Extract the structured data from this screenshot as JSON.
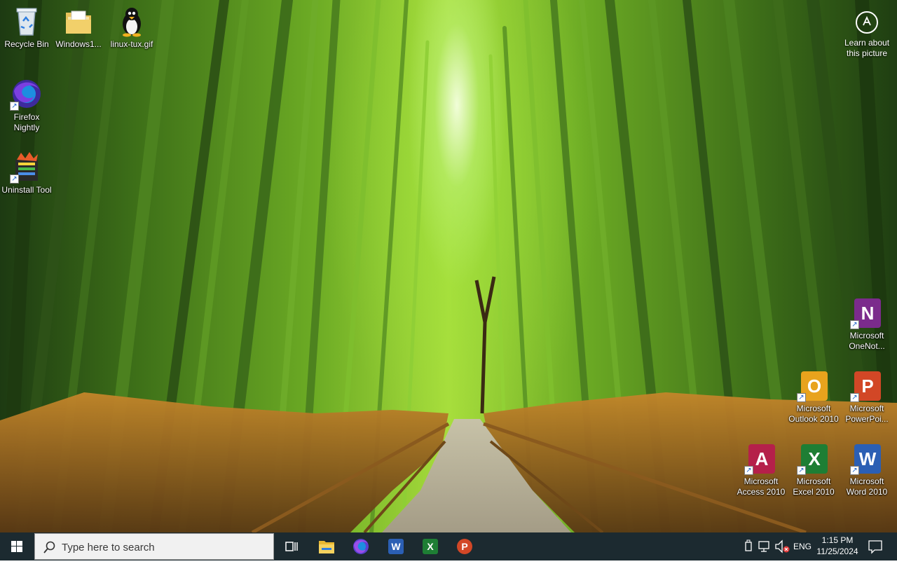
{
  "desktop": {
    "icons_left": [
      {
        "label": "Recycle Bin",
        "icon": "recycle-bin-icon"
      },
      {
        "label": "Windows1...",
        "icon": "folder-icon"
      },
      {
        "label": "linux-tux.gif",
        "icon": "tux-penguin-icon"
      },
      {
        "label": "Firefox Nightly",
        "icon": "firefox-nightly-icon"
      },
      {
        "label": "Uninstall Tool",
        "icon": "uninstall-tool-icon"
      }
    ],
    "icons_right": [
      {
        "label": "Microsoft OneNot...",
        "icon": "onenote-icon",
        "letter": "N",
        "color": "#7b2b8c"
      },
      {
        "label": "Microsoft Outlook 2010",
        "icon": "outlook-icon",
        "letter": "O",
        "color": "#e8a31d"
      },
      {
        "label": "Microsoft PowerPoi...",
        "icon": "powerpoint-icon",
        "letter": "P",
        "color": "#d24726"
      },
      {
        "label": "Microsoft Access 2010",
        "icon": "access-icon",
        "letter": "A",
        "color": "#b5204a"
      },
      {
        "label": "Microsoft Excel 2010",
        "icon": "excel-icon",
        "letter": "X",
        "color": "#1e7e34"
      },
      {
        "label": "Microsoft Word 2010",
        "icon": "word-icon",
        "letter": "W",
        "color": "#2b5fb4"
      }
    ],
    "learn_picture": "Learn about this picture"
  },
  "taskbar": {
    "search_placeholder": "Type here to search",
    "pinned": [
      {
        "name": "task-view",
        "icon": "task-view-icon"
      },
      {
        "name": "file-explorer",
        "icon": "file-explorer-icon"
      },
      {
        "name": "firefox",
        "icon": "firefox-icon"
      },
      {
        "name": "word",
        "icon": "word-icon",
        "letter": "W",
        "color": "#2b5fb4"
      },
      {
        "name": "excel",
        "icon": "excel-icon",
        "letter": "X",
        "color": "#1e7e34"
      },
      {
        "name": "powerpoint",
        "icon": "powerpoint-icon",
        "letter": "P",
        "color": "#d24726"
      }
    ],
    "tray": {
      "language": "ENG",
      "time": "1:15 PM",
      "date": "11/25/2024"
    }
  },
  "colors": {
    "taskbar_bg": "#1c2a30",
    "accent_blue": "#2f7fe0"
  }
}
